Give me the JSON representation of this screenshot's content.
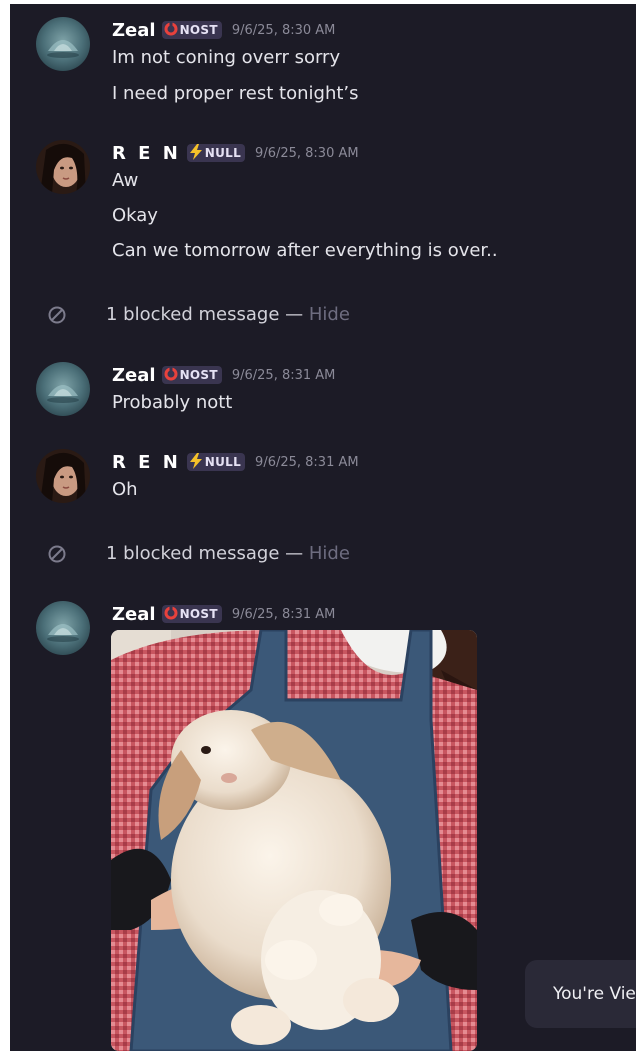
{
  "messages": [
    {
      "username": "Zeal",
      "tag": "NOST",
      "timestamp": "9/6/25, 8:30 AM",
      "lines": [
        "Im not coning overr sorry",
        "I need proper rest tonight’s"
      ]
    },
    {
      "username": "R E N",
      "tag": "NULL",
      "timestamp": "9/6/25, 8:30 AM",
      "lines": [
        "Aw",
        "Okay",
        "Can we tomorrow after everything is over.."
      ]
    },
    {
      "username": "Zeal",
      "tag": "NOST",
      "timestamp": "9/6/25, 8:31 AM",
      "lines": [
        "Probably nott"
      ]
    },
    {
      "username": "R E N",
      "tag": "NULL",
      "timestamp": "9/6/25, 8:31 AM",
      "lines": [
        "Oh"
      ]
    },
    {
      "username": "Zeal",
      "tag": "NOST",
      "timestamp": "9/6/25, 8:31 AM",
      "lines": []
    }
  ],
  "blocked": [
    {
      "text": "1 blocked message —",
      "action": "Hide"
    },
    {
      "text": "1 blocked message —",
      "action": "Hide"
    }
  ],
  "toast": {
    "text": "You're Vie"
  },
  "colors": {
    "background": "#1c1b26",
    "tag_background": "#3a3550",
    "nost_icon": "#e8413c",
    "null_icon": "#f5c22a",
    "timestamp": "#8b8a98",
    "hide_link": "#6e6d80"
  },
  "icons": {
    "nost": "red-ring-icon",
    "null": "lightning-icon",
    "blocked": "blocked-circle-icon"
  }
}
